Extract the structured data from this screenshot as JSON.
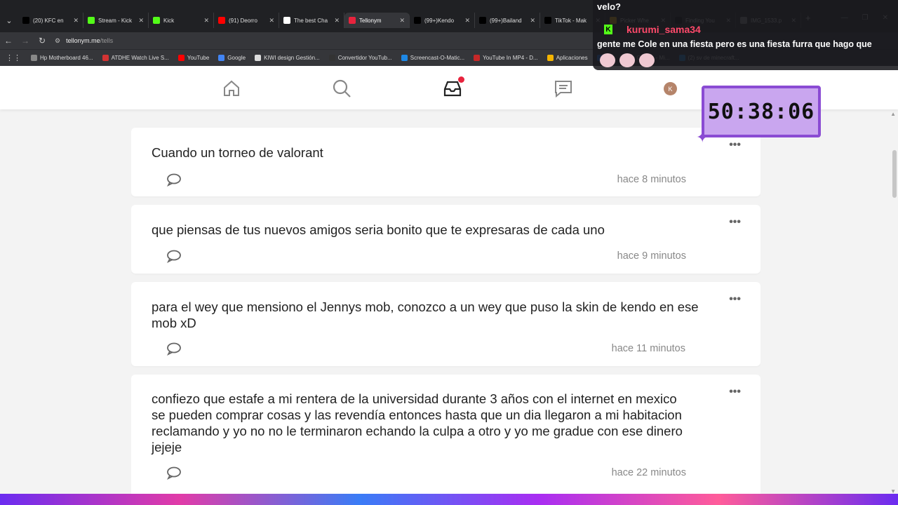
{
  "browser": {
    "tabs": [
      {
        "label": "(20) KFC en",
        "color": "#000000"
      },
      {
        "label": "Stream - Kick",
        "color": "#53fc18"
      },
      {
        "label": "Kick",
        "color": "#53fc18"
      },
      {
        "label": "(91) Deorro",
        "color": "#ff0000"
      },
      {
        "label": "The best Cha",
        "color": "#ffffff"
      },
      {
        "label": "Tellonym",
        "color": "#e8233d",
        "active": true
      },
      {
        "label": "(99+)Kendo",
        "color": "#000000"
      },
      {
        "label": "(99+)Bailand",
        "color": "#000000"
      },
      {
        "label": "TikTok - Mak",
        "color": "#000000"
      },
      {
        "label": "Picker Whe",
        "color": "#f4b400"
      },
      {
        "label": "Finding You",
        "color": "#000000"
      },
      {
        "label": "IMG_1533.p",
        "color": "#888888"
      }
    ],
    "url_host": "tellonym.me",
    "url_path": "/tells",
    "bookmarks": [
      {
        "label": "Hp Motherboard 46...",
        "color": "#888888"
      },
      {
        "label": "ATDHE Watch Live S...",
        "color": "#d33333"
      },
      {
        "label": "YouTube",
        "color": "#ff0000"
      },
      {
        "label": "Google",
        "color": "#4285f4"
      },
      {
        "label": "KIWI design Gestión...",
        "color": "#dddddd"
      },
      {
        "label": "Convertidor YouTub...",
        "color": "#333333"
      },
      {
        "label": "Screencast-O-Matic...",
        "color": "#1e88e5"
      },
      {
        "label": "YouTube In MP4 - D...",
        "color": "#c62828"
      },
      {
        "label": "Aplicaciones",
        "color": "#f4b400"
      },
      {
        "label": "...",
        "color": "#1877f2"
      },
      {
        "label": "de Cliente - Mi...",
        "color": "#666666"
      },
      {
        "label": "(2) sv de minecraft...",
        "color": "#1e88e5"
      }
    ]
  },
  "nav": {
    "avatar_letter": "K"
  },
  "feed": {
    "tells": [
      {
        "text": "Cuando un torneo de valorant",
        "time": "hace 8 minutos"
      },
      {
        "text": "que piensas de tus nuevos amigos seria bonito que te expresaras de cada uno",
        "time": "hace 9 minutos"
      },
      {
        "text": "para el wey que mensiono el Jennys mob, conozco a un wey que puso la skin de kendo en ese mob xD",
        "time": "hace 11 minutos"
      },
      {
        "text": "confiezo que estafe a mi rentera de la universidad durante 3 años con el internet en mexico se pueden comprar cosas y las revendía entonces hasta que un dia llegaron a mi habitacion reclamando y yo no no le terminaron echando la culpa a otro y yo me gradue con ese dinero jejeje",
        "time": "hace 22 minutos"
      }
    ],
    "more_glyph": "•••"
  },
  "overlay": {
    "prev_message": "velo?",
    "chat_username": "kurumi_sama34",
    "chat_message": "gente me Cole en una fiesta pero es una fiesta furra que hago que",
    "timer": "50:38:06"
  },
  "colors": {
    "accent_red": "#e8233d",
    "kick_green": "#53fc18",
    "timer_bg": "#c9a6ef",
    "timer_border": "#8a4bd3"
  }
}
